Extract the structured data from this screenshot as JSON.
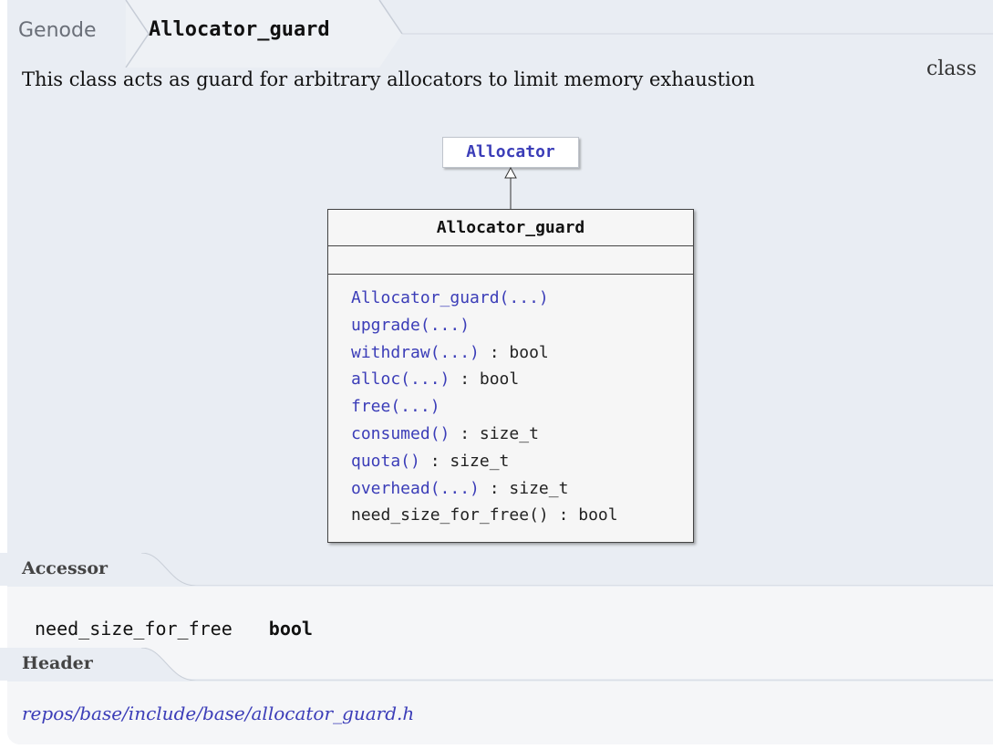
{
  "breadcrumb": {
    "parent": "Genode",
    "current": "Allocator_guard"
  },
  "description": "This class acts as guard for arbitrary allocators to limit memory exhaustion",
  "kind": "class",
  "uml": {
    "base_class": "Allocator",
    "class_name": "Allocator_guard",
    "methods": [
      {
        "name": "Allocator_guard(...)",
        "ret": "",
        "linked": true
      },
      {
        "name": "upgrade(...)",
        "ret": "",
        "linked": true
      },
      {
        "name": "withdraw(...)",
        "ret": " : bool",
        "linked": true
      },
      {
        "name": "alloc(...)",
        "ret": " : bool",
        "linked": true
      },
      {
        "name": "free(...)",
        "ret": "",
        "linked": true
      },
      {
        "name": "consumed()",
        "ret": " : size_t",
        "linked": true
      },
      {
        "name": "quota()",
        "ret": " : size_t",
        "linked": true
      },
      {
        "name": "overhead(...)",
        "ret": " : size_t",
        "linked": true
      },
      {
        "name": "need_size_for_free()",
        "ret": " : bool",
        "linked": false
      }
    ]
  },
  "sections": {
    "accessor": {
      "title": "Accessor",
      "name": "need_size_for_free",
      "type": "bool"
    },
    "header": {
      "title": "Header",
      "path": "repos/base/include/base/allocator_guard.h"
    }
  },
  "colors": {
    "panel": "#e9edf3",
    "link": "#3b3db8"
  }
}
